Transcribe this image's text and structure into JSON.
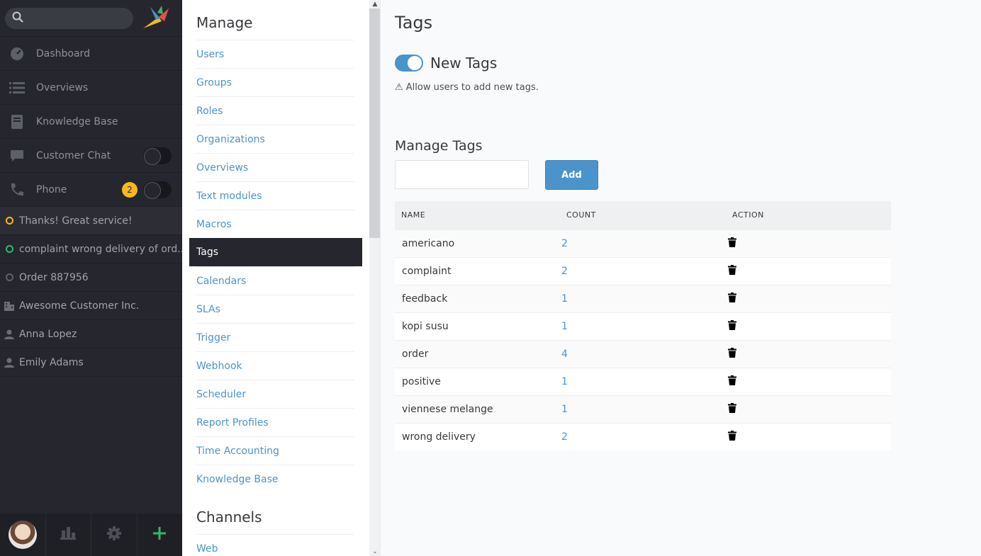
{
  "sidebar": {
    "search_placeholder": "",
    "items": [
      {
        "label": "Dashboard",
        "icon": "dashboard-icon"
      },
      {
        "label": "Overviews",
        "icon": "list-icon"
      },
      {
        "label": "Knowledge Base",
        "icon": "book-icon"
      },
      {
        "label": "Customer Chat",
        "icon": "chat-icon",
        "toggle": "off"
      },
      {
        "label": "Phone",
        "icon": "phone-icon",
        "toggle": "off",
        "badge": "2"
      }
    ],
    "tasks": [
      {
        "label": "Thanks! Great service!",
        "status": "open",
        "status_color": "#f7b821"
      },
      {
        "label": "complaint wrong delivery of ord...",
        "status": "new",
        "status_color": "#39b56a"
      },
      {
        "label": "Order 887956",
        "status": "closed",
        "status_color": "#5d6067"
      },
      {
        "label": "Awesome Customer Inc.",
        "icon": "organization-icon"
      },
      {
        "label": "Anna Lopez",
        "icon": "user-icon"
      },
      {
        "label": "Emily Adams",
        "icon": "user-icon"
      }
    ],
    "bottom_icons": [
      "avatar",
      "stats-icon",
      "gear-icon",
      "plus-icon"
    ]
  },
  "menu": {
    "manage_title": "Manage",
    "items": [
      "Users",
      "Groups",
      "Roles",
      "Organizations",
      "Overviews",
      "Text modules",
      "Macros",
      "Tags",
      "Calendars",
      "SLAs",
      "Trigger",
      "Webhook",
      "Scheduler",
      "Report Profiles",
      "Time Accounting",
      "Knowledge Base"
    ],
    "active": "Tags",
    "channels_title": "Channels",
    "channel_items": [
      "Web"
    ]
  },
  "main": {
    "title": "Tags",
    "new_tags_label": "New Tags",
    "new_tags_enabled": true,
    "hint": "⚠ Allow users to add new tags.",
    "manage_title": "Manage Tags",
    "input_value": "",
    "add_label": "Add",
    "table": {
      "headers": [
        "NAME",
        "COUNT",
        "ACTION"
      ],
      "rows": [
        {
          "name": "americano",
          "count": "2"
        },
        {
          "name": "complaint",
          "count": "2"
        },
        {
          "name": "feedback",
          "count": "1"
        },
        {
          "name": "kopi susu",
          "count": "1"
        },
        {
          "name": "order",
          "count": "4"
        },
        {
          "name": "positive",
          "count": "1"
        },
        {
          "name": "viennese melange",
          "count": "1"
        },
        {
          "name": "wrong delivery",
          "count": "2"
        }
      ]
    }
  },
  "colors": {
    "accent": "#4a94cb",
    "sidebar_bg": "#26272e",
    "badge": "#f7b821"
  }
}
